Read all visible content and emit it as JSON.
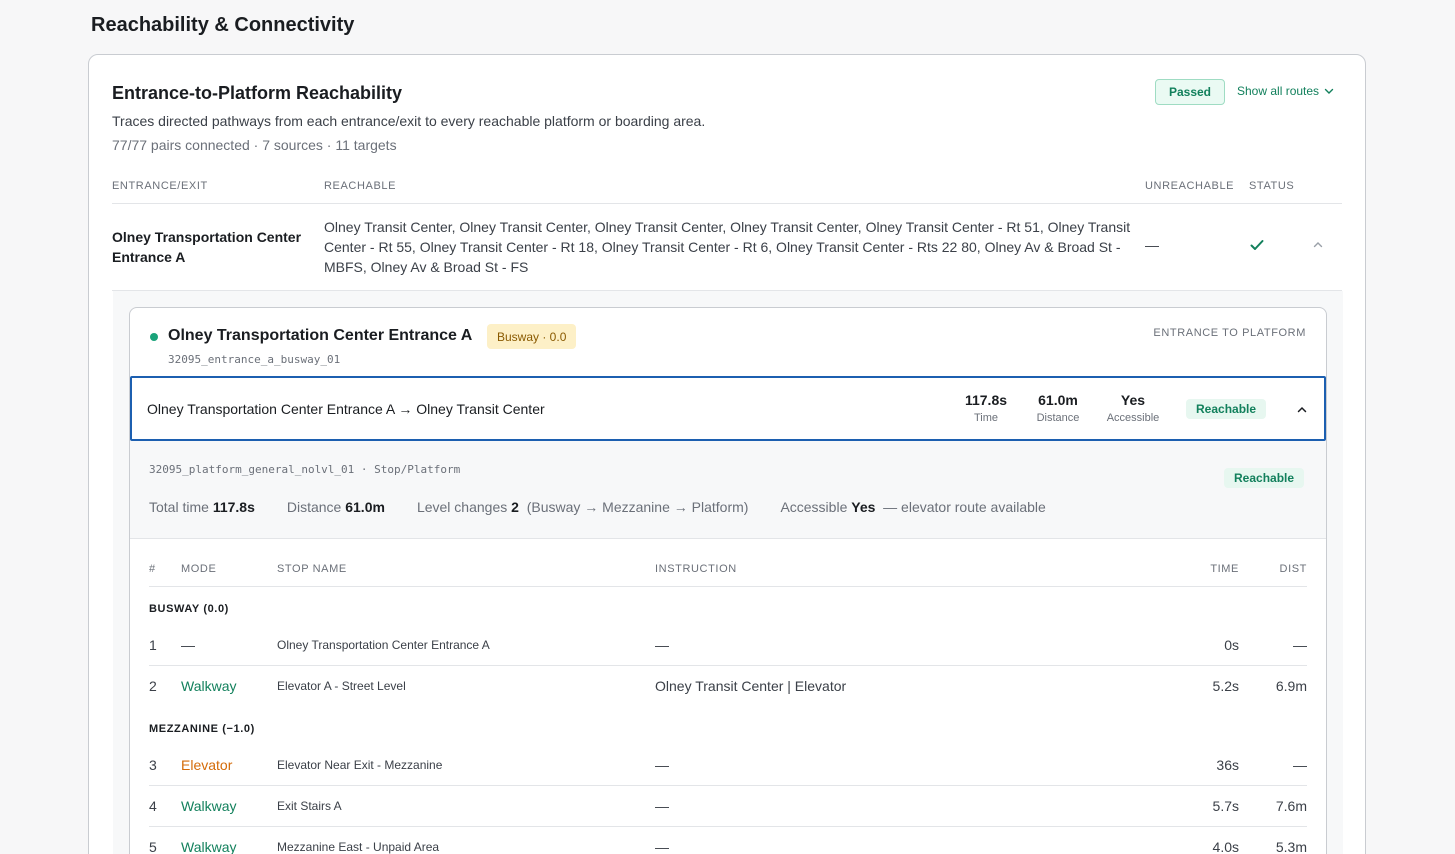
{
  "section": {
    "title": "Reachability & Connectivity"
  },
  "card": {
    "title": "Entrance-to-Platform Reachability",
    "description": "Traces directed pathways from each entrance/exit to every reachable platform or boarding area.",
    "summary": "77/77 pairs connected · 7 sources · 11 targets",
    "status_badge": "Passed",
    "show_routes": "Show all routes"
  },
  "table": {
    "headers": [
      "Entrance/Exit",
      "Reachable",
      "Unreachable",
      "Status"
    ],
    "rows": [
      {
        "name": "Olney Transportation Center Entrance A",
        "reachable": "Olney Transit Center, Olney Transit Center, Olney Transit Center, Olney Transit Center, Olney Transit Center - Rt 51, Olney Transit Center - Rt 55, Olney Transit Center - Rt 18, Olney Transit Center - Rt 6, Olney Transit Center - Rts 22 80, Olney Av & Broad St - MBFS, Olney Av & Broad St - FS",
        "unreachable": "—"
      }
    ]
  },
  "entrance": {
    "name": "Olney Transportation Center Entrance A",
    "badge": "Busway · 0.0",
    "id": "32095_entrance_a_busway_01",
    "type": "Entrance to Platform"
  },
  "route": {
    "title": "Olney Transportation Center Entrance A → Olney Transit Center",
    "metrics": [
      {
        "value": "117.8s",
        "label": "Time"
      },
      {
        "value": "61.0m",
        "label": "Distance"
      },
      {
        "value": "Yes",
        "label": "Accessible"
      }
    ],
    "status": "Reachable"
  },
  "detail": {
    "target_id": "32095_platform_general_nolvl_01 · Stop/Platform",
    "status": "Reachable",
    "total_time_label": "Total time",
    "total_time": "117.8s",
    "distance_label": "Distance",
    "distance": "61.0m",
    "level_changes_label": "Level changes",
    "level_changes": "2",
    "level_path": "(Busway → Mezzanine → Platform)",
    "accessible_label": "Accessible",
    "accessible": "Yes",
    "accessible_note": "— elevator route available"
  },
  "steps": {
    "headers": [
      "#",
      "Mode",
      "Stop Name",
      "Instruction",
      "Time",
      "Dist"
    ],
    "groups": [
      {
        "label": "Busway (0.0)",
        "rows": [
          {
            "n": "1",
            "mode": "—",
            "stop": "Olney Transportation Center Entrance A",
            "instruction": "—",
            "time": "0s",
            "dist": "—"
          },
          {
            "n": "2",
            "mode": "Walkway",
            "stop": "Elevator A - Street Level",
            "instruction": "Olney Transit Center | Elevator",
            "time": "5.2s",
            "dist": "6.9m"
          }
        ]
      },
      {
        "label": "Mezzanine (−1.0)",
        "rows": [
          {
            "n": "3",
            "mode": "Elevator",
            "stop": "Elevator Near Exit - Mezzanine",
            "instruction": "—",
            "time": "36s",
            "dist": "—"
          },
          {
            "n": "4",
            "mode": "Walkway",
            "stop": "Exit Stairs A",
            "instruction": "—",
            "time": "5.7s",
            "dist": "7.6m"
          },
          {
            "n": "5",
            "mode": "Walkway",
            "stop": "Mezzanine East - Unpaid Area",
            "instruction": "—",
            "time": "4.0s",
            "dist": "5.3m"
          }
        ]
      }
    ]
  },
  "colors": {
    "accent_green": "#12805c",
    "focus_blue": "#1c5fb0",
    "elevator_orange": "#d46b08"
  }
}
